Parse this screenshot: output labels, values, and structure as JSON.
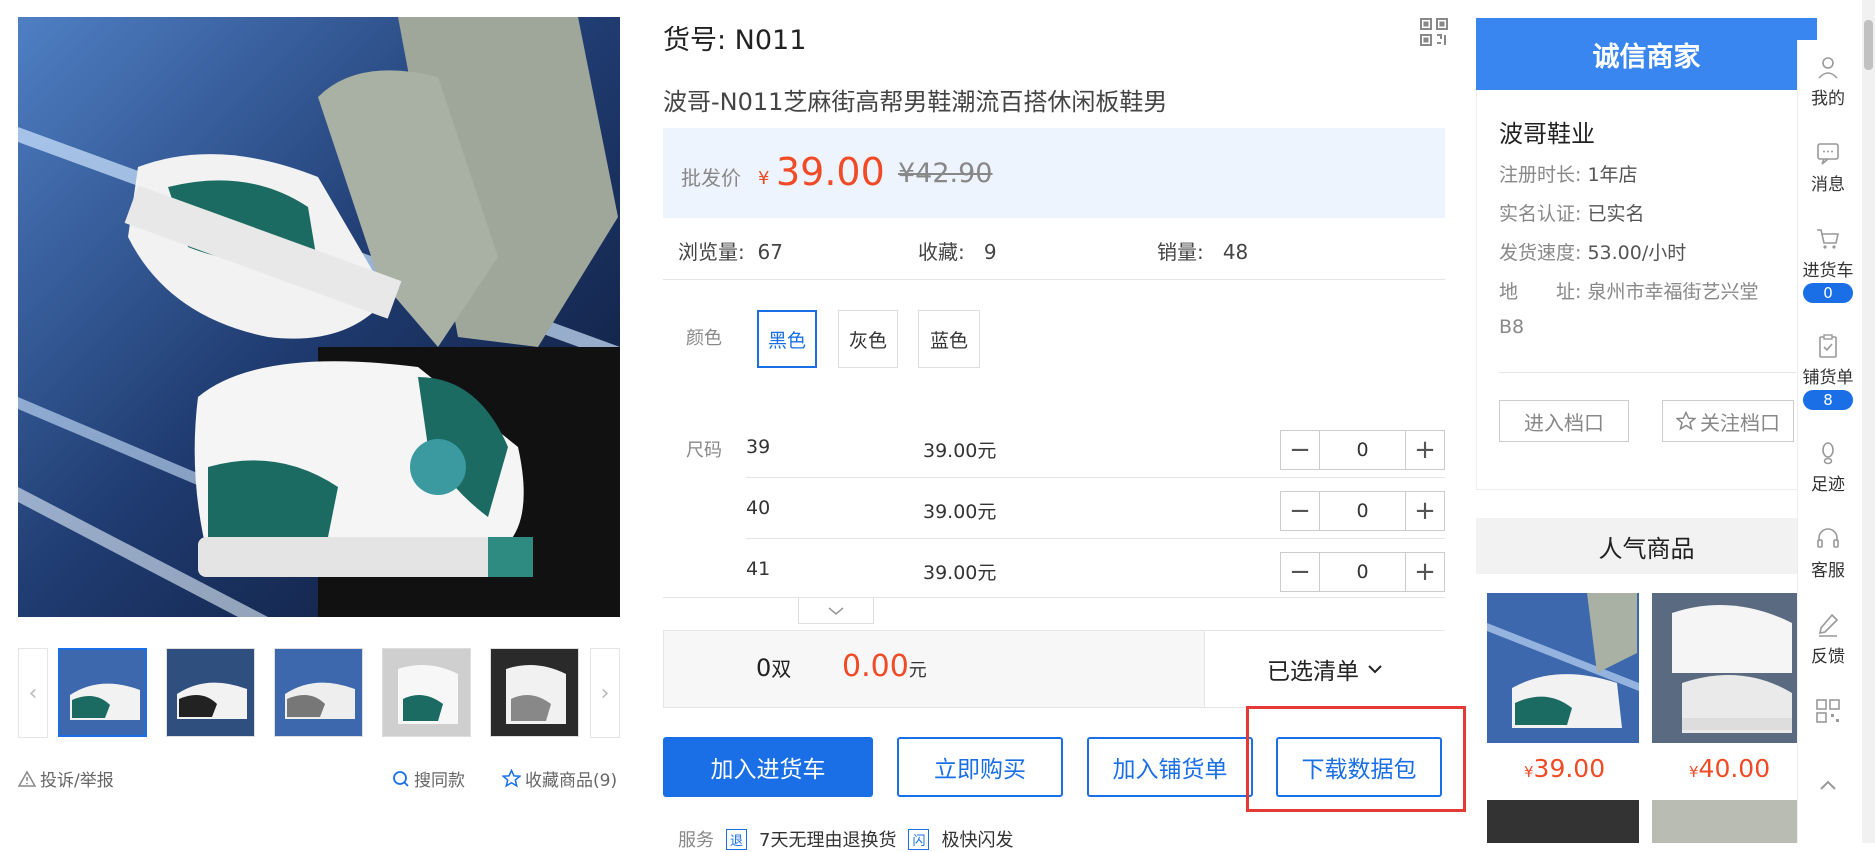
{
  "product": {
    "sku_code": "货号: N011",
    "title": "波哥-N011芝麻街高帮男鞋潮流百搭休闲板鞋男",
    "price_label": "批发价",
    "currency": "¥",
    "price": "39.00",
    "old_price": "¥42.90",
    "stats": [
      {
        "label": "浏览量:",
        "value": "67"
      },
      {
        "label": "收藏:",
        "value": "9"
      },
      {
        "label": "销量:",
        "value": "48"
      }
    ],
    "color_label": "颜色",
    "colors": [
      "黑色",
      "灰色",
      "蓝色"
    ],
    "selected_color_index": 0,
    "size_label": "尺码",
    "sizes": [
      {
        "size": "39",
        "price": "39.00元",
        "qty": "0"
      },
      {
        "size": "40",
        "price": "39.00元",
        "qty": "0"
      },
      {
        "size": "41",
        "price": "39.00元",
        "qty": "0"
      }
    ],
    "summary": {
      "pairs": "0",
      "pairs_unit": "双",
      "total": "0.00",
      "total_unit": "元",
      "list_label": "已选清单"
    },
    "actions": [
      "加入进货车",
      "立即购买",
      "加入铺货单",
      "下载数据包"
    ],
    "service": {
      "label": "服务",
      "items": [
        {
          "icon": "退",
          "text": "7天无理由退换货"
        },
        {
          "icon": "闪",
          "text": "极快闪发"
        }
      ]
    }
  },
  "gallery": {
    "links": {
      "report": "投诉/举报",
      "same": "搜同款",
      "fav": "收藏商品(9)"
    }
  },
  "shop": {
    "header": "诚信商家",
    "name": "波哥鞋业",
    "info": [
      {
        "label": "注册时长:",
        "value": "1年店"
      },
      {
        "label": "实名认证:",
        "value": "已实名"
      },
      {
        "label": "发货速度:",
        "value": "53.00/小时"
      },
      {
        "label": "地　　址:",
        "value": "泉州市幸福街艺兴堂"
      }
    ],
    "address_cont": "B8",
    "enter_btn": "进入档口",
    "follow_btn": "关注档口"
  },
  "hot": {
    "header": "人气商品",
    "items": [
      {
        "price": "39.00"
      },
      {
        "price": "40.00"
      }
    ]
  },
  "sidebar": {
    "items": [
      {
        "label": "我的",
        "icon": "user-icon"
      },
      {
        "label": "消息",
        "icon": "message-icon"
      },
      {
        "label": "进货车",
        "icon": "cart-icon",
        "badge": "0"
      },
      {
        "label": "铺货单",
        "icon": "clipboard-icon",
        "badge": "8"
      },
      {
        "label": "足迹",
        "icon": "footprint-icon"
      },
      {
        "label": "客服",
        "icon": "headset-icon"
      },
      {
        "label": "反馈",
        "icon": "pen-icon"
      }
    ]
  },
  "colors": {
    "accent": "#1a6fe6",
    "price": "#f04b26",
    "shop_header": "#3a86f0",
    "highlight": "#e53935"
  }
}
